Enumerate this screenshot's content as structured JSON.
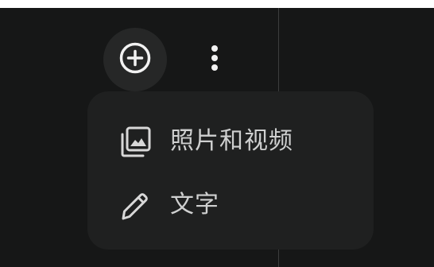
{
  "toolbar": {
    "add_icon": "add-circle-icon",
    "more_icon": "more-vertical-icon"
  },
  "menu": {
    "items": [
      {
        "label": "照片和视频",
        "icon": "photo-library-icon"
      },
      {
        "label": "文字",
        "icon": "pencil-icon"
      }
    ]
  },
  "colors": {
    "background": "#161717",
    "menu_background": "#1f2020",
    "text": "#cfd0d0",
    "icon": "#e6e6e6"
  }
}
